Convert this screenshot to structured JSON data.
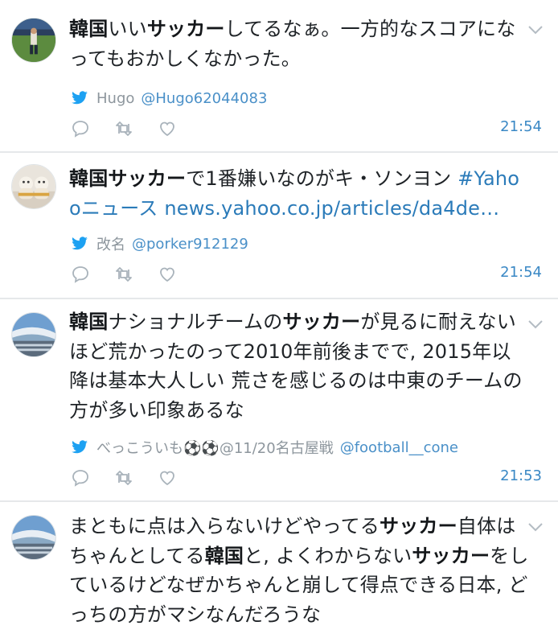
{
  "tweets": [
    {
      "segments": [
        {
          "text": "韓国",
          "bold": true
        },
        {
          "text": "いい"
        },
        {
          "text": "サッカー",
          "bold": true
        },
        {
          "text": "してるなぁ。一方的なスコアになってもおかしくなかった。"
        }
      ],
      "user_name": "Hugo",
      "handle": "@Hugo62044083",
      "time": "21:54",
      "avatar_icon": "soccer-player-photo"
    },
    {
      "segments": [
        {
          "text": "韓国",
          "bold": true
        },
        {
          "text": "サッカー",
          "bold": true
        },
        {
          "text": "で1番嫌いなのがキ・ソンヨン "
        },
        {
          "text": "#Yahooニュース",
          "link": true
        },
        {
          "text": " "
        },
        {
          "text": "news.yahoo.co.jp/articles/da4de…",
          "link": true
        }
      ],
      "user_name": "改名",
      "handle": "@porker912129",
      "time": "21:54",
      "avatar_icon": "stuffed-toys-photo"
    },
    {
      "segments": [
        {
          "text": "韓国",
          "bold": true
        },
        {
          "text": "ナショナルチームの"
        },
        {
          "text": "サッカー",
          "bold": true
        },
        {
          "text": "が見るに耐えないほど荒かったのって2010年前後までで, 2015年以降は基本大人しい 荒さを感じるのは中東のチームの方が多い印象あるな"
        }
      ],
      "user_name": "べっこういも⚽⚽@11/20名古屋戦",
      "handle": "@football__cone",
      "time": "21:53",
      "avatar_icon": "stadium-photo"
    },
    {
      "segments": [
        {
          "text": "まともに点は入らないけどやってる"
        },
        {
          "text": "サッカー",
          "bold": true
        },
        {
          "text": "自体はちゃんとしてる"
        },
        {
          "text": "韓国",
          "bold": true
        },
        {
          "text": "と, よくわからない"
        },
        {
          "text": "サッカー",
          "bold": true
        },
        {
          "text": "をしているけどなぜかちゃんと崩して得点できる日本, どっちの方がマシなんだろうな"
        }
      ],
      "avatar_icon": "stadium-photo"
    }
  ],
  "icons": {
    "reply": "reply-icon",
    "retweet": "retweet-icon",
    "like": "heart-icon",
    "source": "twitter-bird-icon",
    "menu": "chevron-down-icon"
  },
  "colors": {
    "link": "#2b7bb9",
    "handle": "#4a90c8",
    "time": "#3a88c5",
    "muted": "#8d969d",
    "divider": "#e6e8ea"
  }
}
